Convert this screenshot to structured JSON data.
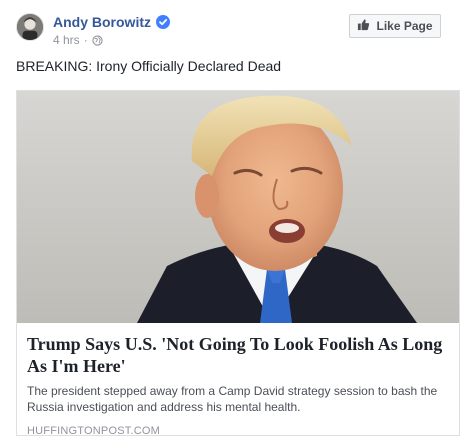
{
  "post": {
    "author": "Andy Borowitz",
    "verified": true,
    "timestamp": "4 hrs",
    "separator": "·",
    "audience_icon": "globe-icon",
    "status_text": "BREAKING: Irony Officially Declared Dead"
  },
  "like_page": {
    "label": "Like Page",
    "icon": "thumbs-up-icon"
  },
  "link_card": {
    "title": "Trump Says U.S. 'Not Going To Look Foolish As Long As I'm Here'",
    "description": "The president stepped away from a Camp David strategy session to bash the Russia investigation and address his mental health.",
    "domain": "HUFFINGTONPOST.COM"
  },
  "colors": {
    "author_link": "#365899",
    "verified_badge": "#4080ff",
    "meta_text": "#90949c",
    "button_bg": "#f6f7f9",
    "card_border": "#dddfe2"
  }
}
